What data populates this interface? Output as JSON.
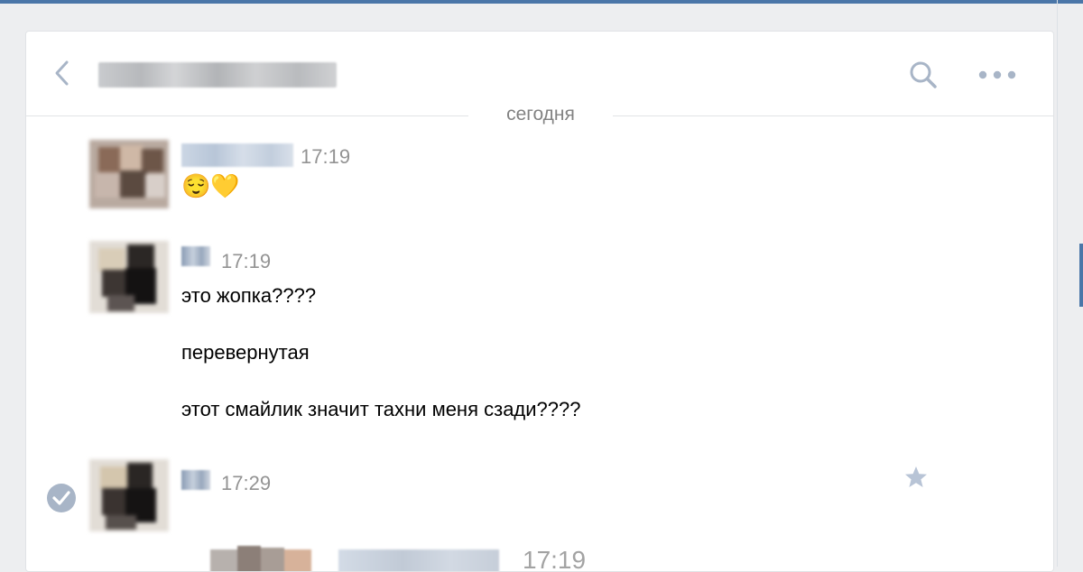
{
  "header": {
    "back_icon": "chevron-left-icon",
    "title": "",
    "search_icon": "search-icon",
    "more_icon": "more-horizontal-icon"
  },
  "divider": {
    "date": "сегодня"
  },
  "messages": [
    {
      "author": "",
      "time": "17:19",
      "lines": [
        "😌💛"
      ]
    },
    {
      "author": "",
      "time": "17:19",
      "lines": [
        "это жопка????",
        "перевернутая",
        "этот смайлик значит тахни меня сзади????"
      ]
    },
    {
      "author": "",
      "time": "17:29",
      "lines": [],
      "selected": true,
      "forwarded": {
        "author": "",
        "time": "17:19"
      }
    }
  ],
  "colors": {
    "accent": "#4a76a8",
    "icon": "#a8b5c7",
    "muted_text": "#939393"
  }
}
